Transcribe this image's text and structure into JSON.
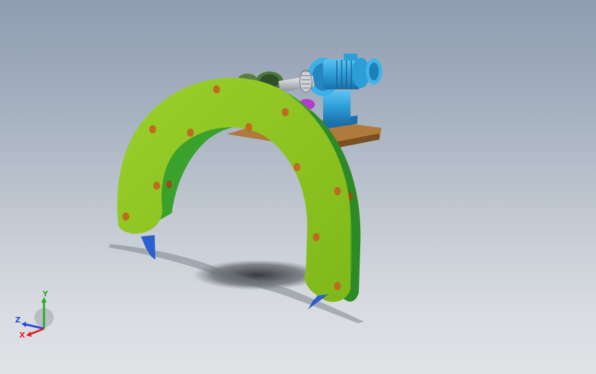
{
  "viewport": {
    "background_top": "#8e9db1",
    "background_bottom": "#e0e3e6"
  },
  "model": {
    "arc_color": "#8dc21f",
    "arc_edge_color": "#3aa12c",
    "motor_color": "#2c9ed8",
    "base_plate_color": "#b07a3a",
    "blade_color": "#2c5fd0",
    "bevel_gear_color": "#b53bd0",
    "hole_count_outer": 11,
    "hole_count_inner": 3
  },
  "triad": {
    "x_label": "X",
    "y_label": "Y",
    "z_label": "Z",
    "x_color": "#e0242b",
    "y_color": "#2fa52f",
    "z_color": "#2c46d8"
  }
}
